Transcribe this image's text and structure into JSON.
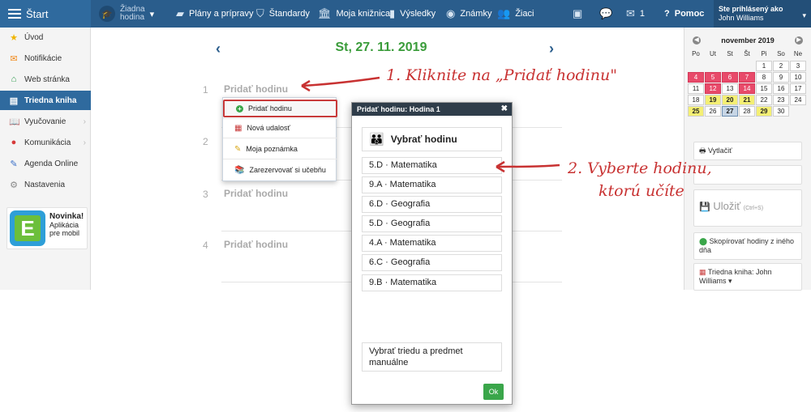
{
  "topbar": {
    "start_label": "Štart",
    "no_hour_line1": "Žiadna",
    "no_hour_line2": "hodina",
    "nav": [
      "Plány a prípravy",
      "Štandardy",
      "Moja knižnica",
      "Výsledky",
      "Známky",
      "Žiaci"
    ],
    "mail_count": "1",
    "help_label": "Pomoc",
    "user_caption": "Ste prihlásený ako",
    "user_name": "John Williams"
  },
  "sidebar": {
    "items": [
      {
        "label": "Úvod"
      },
      {
        "label": "Notifikácie"
      },
      {
        "label": "Web stránka"
      },
      {
        "label": "Triedna kniha"
      },
      {
        "label": "Vyučovanie"
      },
      {
        "label": "Komunikácia"
      },
      {
        "label": "Agenda Online"
      },
      {
        "label": "Nastavenia"
      }
    ],
    "promo": {
      "title": "Novinka!",
      "line1": "Aplikácia",
      "line2": "pre mobil",
      "logo_letter": "E"
    }
  },
  "main": {
    "date": "St, 27. 11. 2019",
    "lessons": [
      {
        "num": "1",
        "label": "Pridať hodinu"
      },
      {
        "num": "2",
        "label": ""
      },
      {
        "num": "3",
        "label": "Pridať hodinu"
      },
      {
        "num": "4",
        "label": "Pridať hodinu"
      }
    ],
    "menu": [
      "Pridať hodinu",
      "Nová udalosť",
      "Moja poznámka",
      "Zarezervovať si učebňu"
    ]
  },
  "modal": {
    "title": "Pridať hodinu: Hodina 1",
    "section": "Vybrať hodinu",
    "options": [
      "5.D · Matematika",
      "9.A · Matematika",
      "6.D · Geografia",
      "5.D · Geografia",
      "4.A · Matematika",
      "6.C · Geografia",
      "9.B · Matematika"
    ],
    "manual": "Vybrať triedu a predmet manuálne",
    "ok": "Ok"
  },
  "calendar": {
    "title": "november 2019",
    "dows": [
      "Po",
      "Ut",
      "St",
      "Št",
      "Pi",
      "So",
      "Ne"
    ],
    "days": [
      "",
      "",
      "",
      "",
      "1",
      "2",
      "3",
      "4",
      "5",
      "6",
      "7",
      "8",
      "9",
      "10",
      "11",
      "12",
      "13",
      "14",
      "15",
      "16",
      "17",
      "18",
      "19",
      "20",
      "21",
      "22",
      "23",
      "24",
      "25",
      "26",
      "27",
      "28",
      "29",
      "30"
    ]
  },
  "right": {
    "print": "Vytlačiť",
    "save": "Uložiť",
    "save_hint": "(Ctrl+S)",
    "copy": "Skopírovať hodiny z iného dňa",
    "book": "Triedna kniha: John Williams ▾"
  },
  "annotations": {
    "step1": "1. Kliknite na „Pridať hodinu\"",
    "step2_line1": "2. Vyberte hodinu,",
    "step2_line2": "ktorú učíte"
  },
  "colors": {
    "topbar": "#2a5d8c",
    "accent_green": "#3a9c3a",
    "annotation_red": "#c83232"
  }
}
